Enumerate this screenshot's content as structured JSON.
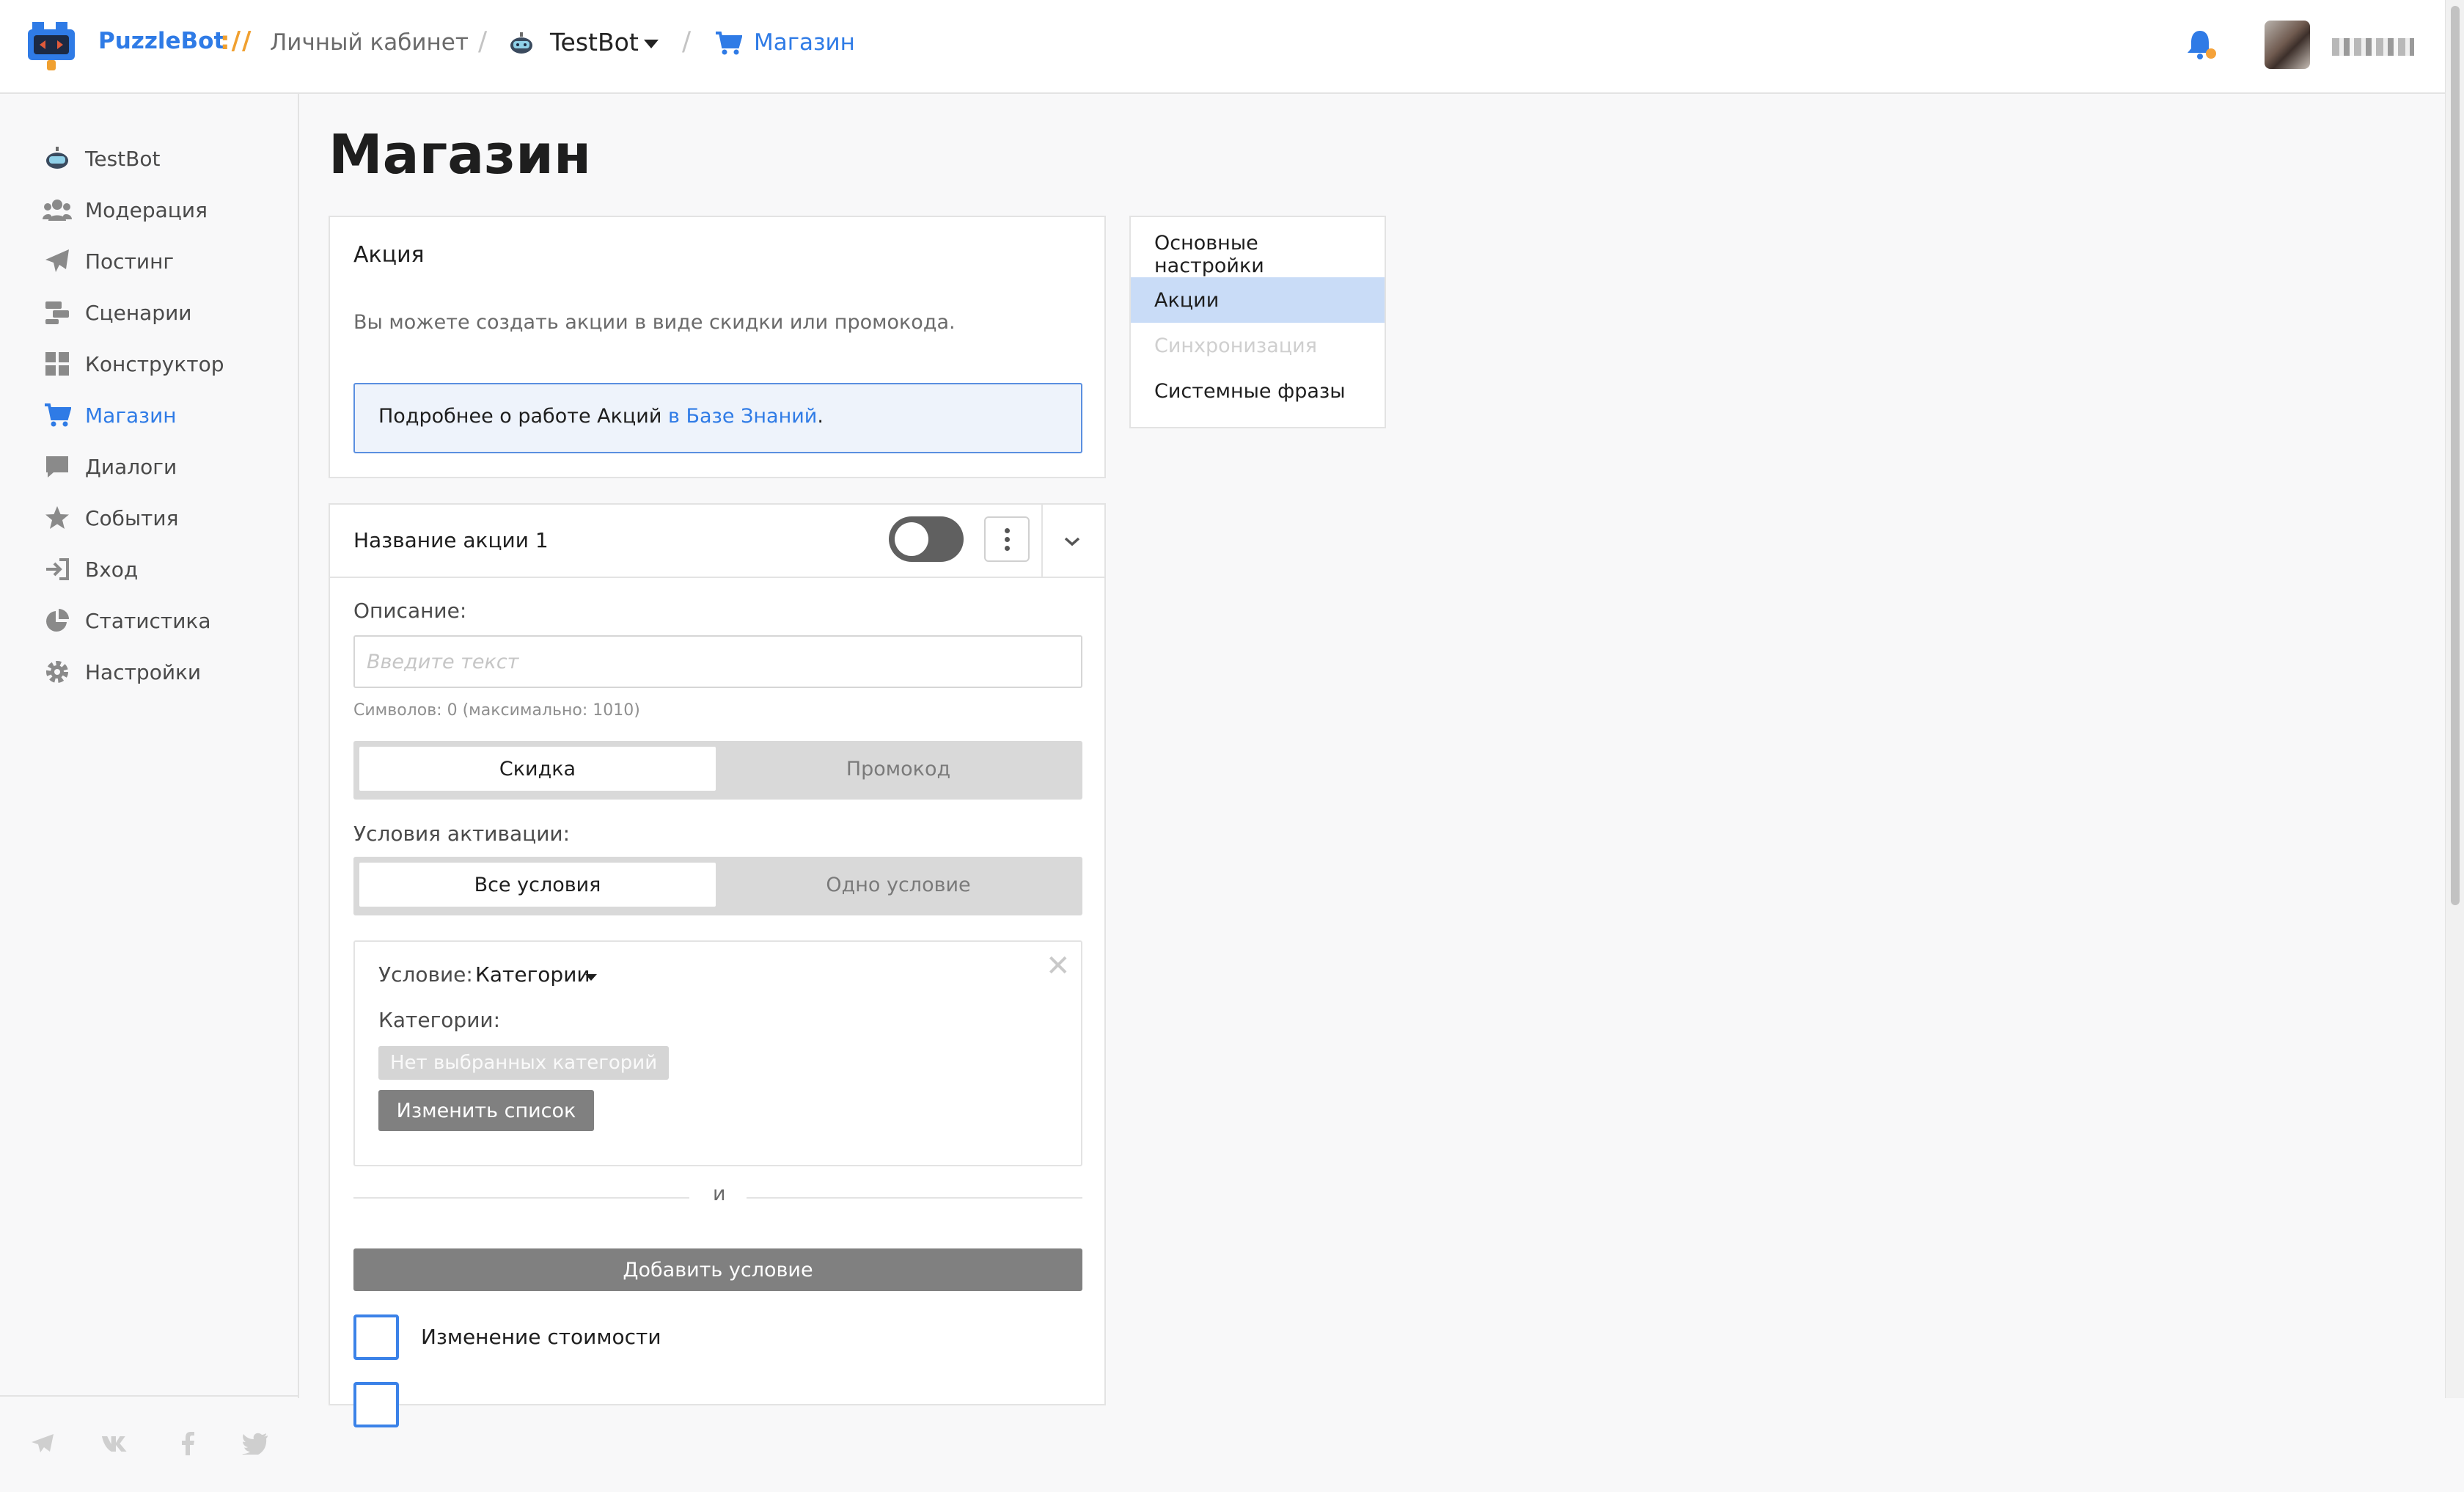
{
  "header": {
    "brand": "PuzzleBot",
    "brand_sep": "://",
    "cabinet": "Личный кабинет",
    "bot_name": "TestBot",
    "current": "Магазин",
    "accent_color": "#2f7be6",
    "notify_icon": "bell-icon"
  },
  "sidebar": {
    "items": [
      {
        "label": "TestBot",
        "icon": "bot-icon"
      },
      {
        "label": "Модерация",
        "icon": "users-icon"
      },
      {
        "label": "Постинг",
        "icon": "paper-plane-icon"
      },
      {
        "label": "Сценарии",
        "icon": "scenario-icon"
      },
      {
        "label": "Конструктор",
        "icon": "grid-icon"
      },
      {
        "label": "Магазин",
        "icon": "cart-icon",
        "active": true
      },
      {
        "label": "Диалоги",
        "icon": "chat-icon"
      },
      {
        "label": "События",
        "icon": "star-icon"
      },
      {
        "label": "Вход",
        "icon": "sign-in-icon"
      },
      {
        "label": "Статистика",
        "icon": "pie-chart-icon"
      },
      {
        "label": "Настройки",
        "icon": "gear-icon"
      }
    ],
    "social": [
      "telegram-icon",
      "vk-icon",
      "facebook-icon",
      "twitter-icon"
    ]
  },
  "main": {
    "title": "Магазин",
    "promo_card": {
      "title": "Акция",
      "description": "Вы можете создать акции в виде скидки или промокода.",
      "info_text": "Подробнее о работе Акций ",
      "info_link": "в Базе Знаний",
      "info_end": "."
    },
    "settings_tabs": [
      {
        "label": "Основные настройки",
        "state": "normal"
      },
      {
        "label": "Акции",
        "state": "active"
      },
      {
        "label": "Синхронизация",
        "state": "disabled"
      },
      {
        "label": "Системные фразы",
        "state": "normal"
      }
    ],
    "action": {
      "name": "Название акции 1",
      "enabled": false,
      "description_label": "Описание:",
      "description_value": "",
      "description_placeholder": "Введите текст",
      "counter": "Символов: 0 (максимально: 1010)",
      "type_options": [
        "Скидка",
        "Промокод"
      ],
      "type_selected": "Скидка",
      "activation_label": "Условия активации:",
      "activation_options": [
        "Все условия",
        "Одно условие"
      ],
      "activation_selected": "Все условия",
      "condition": {
        "label": "Условие:",
        "value": "Категории",
        "categories_label": "Категории:",
        "empty_badge": "Нет выбранных категорий",
        "edit_button": "Изменить список"
      },
      "and_text": "и",
      "add_condition": "Добавить условие",
      "price_change": "Изменение стоимости",
      "price_change_checked": false
    }
  }
}
